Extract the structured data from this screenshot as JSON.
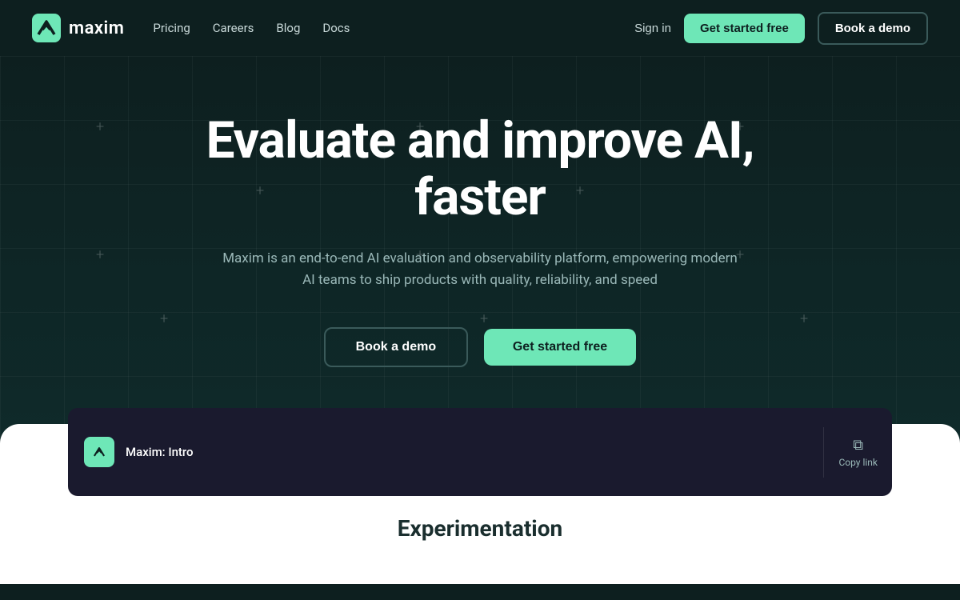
{
  "nav": {
    "logo_text": "maxim",
    "links": [
      {
        "label": "Pricing",
        "key": "pricing"
      },
      {
        "label": "Careers",
        "key": "careers"
      },
      {
        "label": "Blog",
        "key": "blog"
      },
      {
        "label": "Docs",
        "key": "docs"
      }
    ],
    "sign_in": "Sign in",
    "get_started": "Get started free",
    "book_demo": "Book a demo"
  },
  "hero": {
    "title": "Evaluate and improve AI, faster",
    "subtitle": "Maxim is an end-to-end AI evaluation and observability platform, empowering modern AI teams to ship products with quality, reliability, and speed",
    "book_demo_label": "Book a demo",
    "get_started_label": "Get started free"
  },
  "video_card": {
    "title": "Maxim: Intro",
    "copy_link_label": "Copy link"
  },
  "bottom": {
    "section_label": "Experimentation"
  }
}
